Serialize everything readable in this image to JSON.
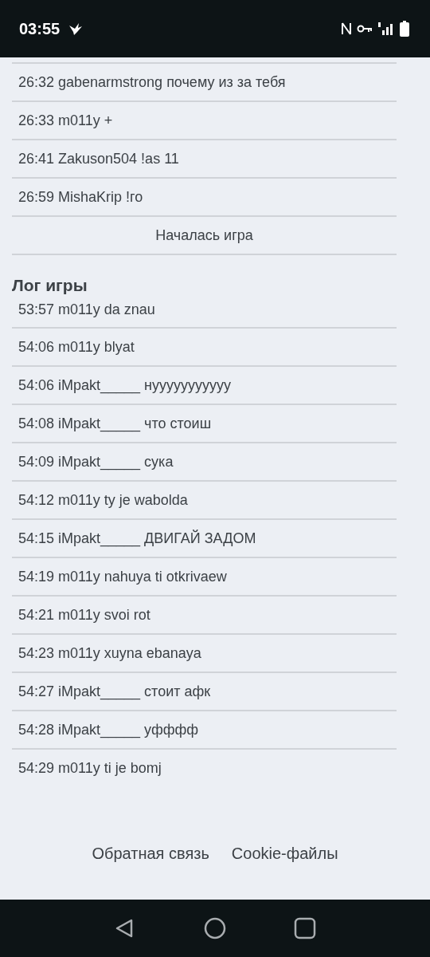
{
  "status_bar": {
    "time": "03:55"
  },
  "chat": {
    "messages": [
      "26:32 gabenarmstrong почему из за тебя",
      "26:33 m011y +",
      "26:41 Zakuson504 !as 11",
      "26:59 MishaKrip !го"
    ],
    "notice": "Началась игра"
  },
  "game_log": {
    "title": "Лог игры",
    "entries": [
      "53:57 m011y da znau",
      "54:06 m011y blyat",
      "54:06 iMpakt_____ нууууууууууу",
      "54:08 iMpakt_____ что стоиш",
      "54:09 iMpakt_____ сука",
      "54:12 m011y ty je wabolda",
      "54:15 iMpakt_____ ДВИГАЙ ЗАДОМ",
      "54:19 m011y nahuya ti otkrivaew",
      "54:21 m011y svoi rot",
      "54:23 m011y xuyna ebanaya",
      "54:27 iMpakt_____ стоит афк",
      "54:28 iMpakt_____ уфффф",
      "54:29 m011y ti je bomj"
    ]
  },
  "footer": {
    "links": [
      "Обратная связь",
      "Cookie-файлы"
    ]
  }
}
